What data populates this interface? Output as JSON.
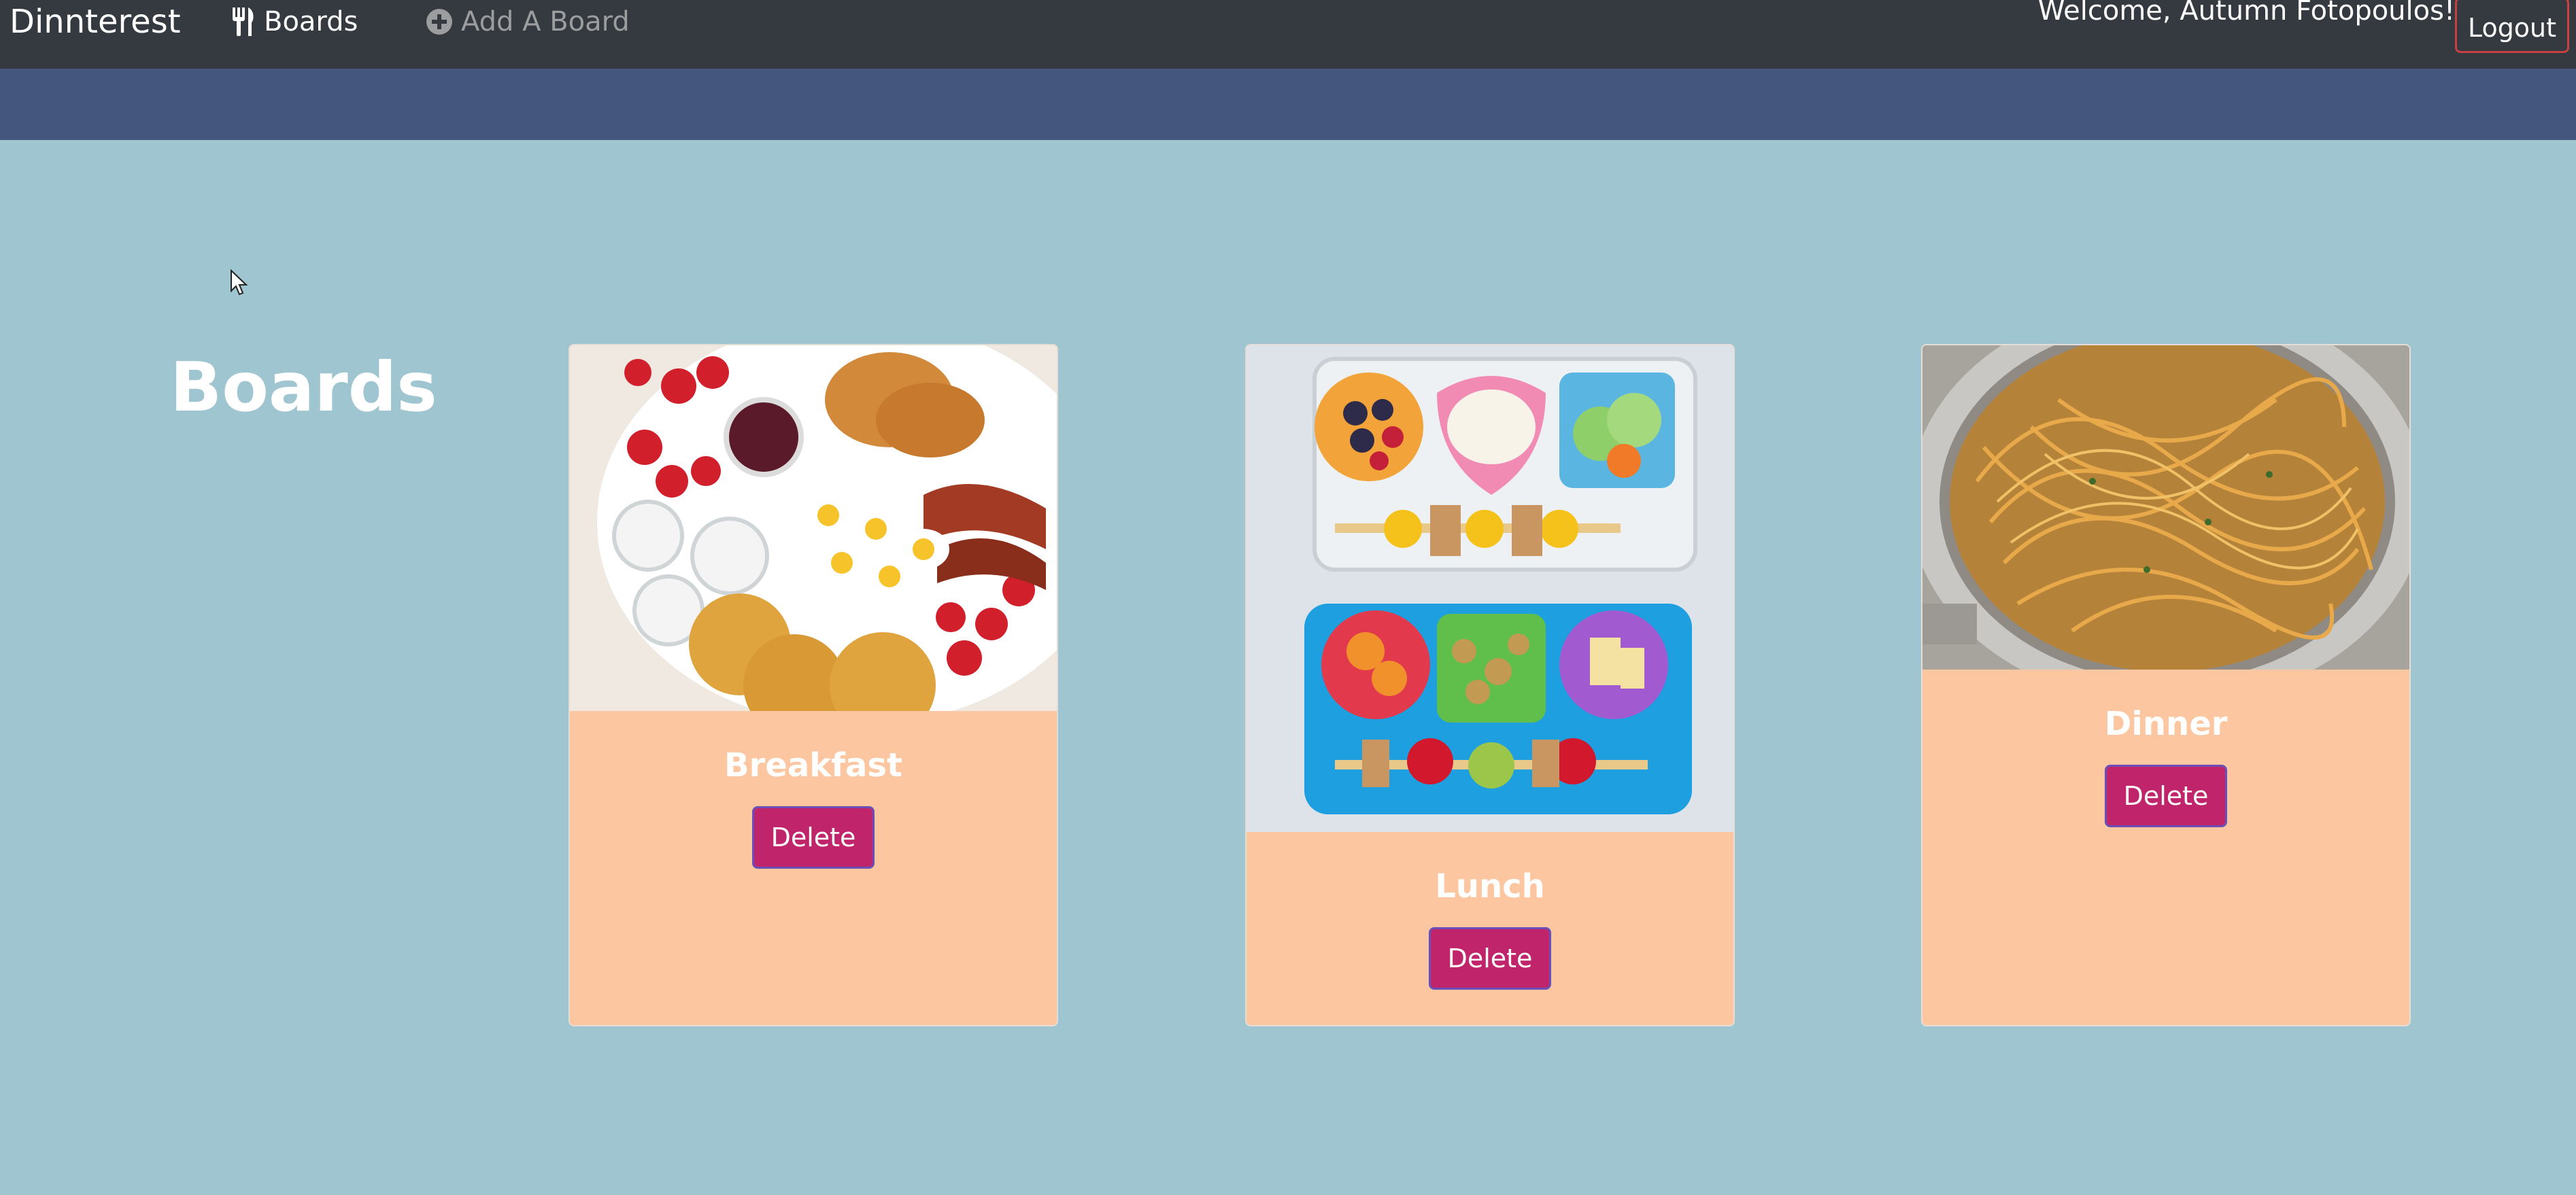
{
  "navbar": {
    "brand": "Dinnterest",
    "boards_link": "Boards",
    "add_board_link": "Add A Board",
    "welcome_text": "Welcome, Autumn Fotopoulos!",
    "logout_label": "Logout"
  },
  "main": {
    "title": "Boards",
    "boards": [
      {
        "name": "Breakfast",
        "delete_label": "Delete"
      },
      {
        "name": "Lunch",
        "delete_label": "Delete"
      },
      {
        "name": "Dinner",
        "delete_label": "Delete"
      }
    ]
  },
  "icons": {
    "boards": "utensils-icon",
    "add_board": "plus-circle-icon"
  },
  "colors": {
    "navbar": "#343a40",
    "subbar": "#44557e",
    "page_bg": "#9fc6d0",
    "card_bg": "#fbc6a0",
    "delete_btn": "#c0246a",
    "logout_border": "#c64141"
  }
}
